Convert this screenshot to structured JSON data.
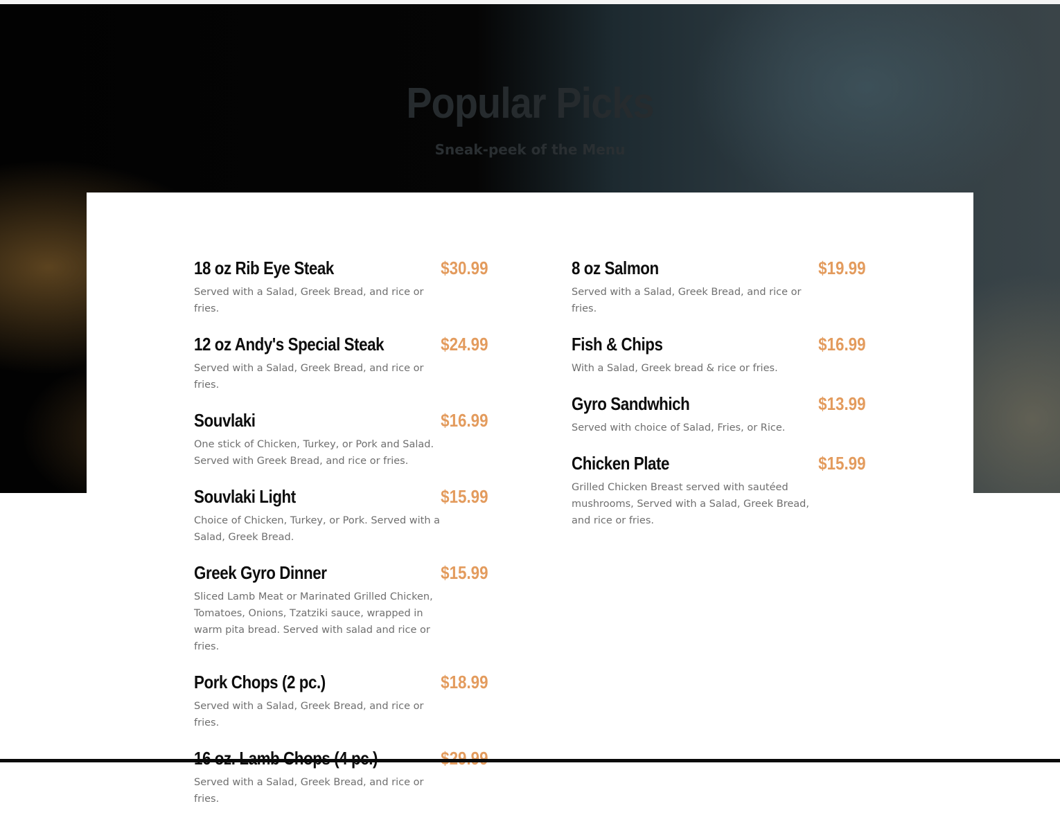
{
  "hero": {
    "title": "Popular Picks",
    "subtitle": "Sneak-peek of the Menu"
  },
  "colors": {
    "price": "#e39b5d",
    "item_name": "#0d0d0d",
    "description": "#6f6f6f"
  },
  "menu": {
    "left": [
      {
        "name": "18 oz Rib Eye Steak",
        "price": "$30.99",
        "description": "Served with a Salad, Greek Bread, and rice or fries."
      },
      {
        "name": "12 oz Andy's Special Steak",
        "price": "$24.99",
        "description": "Served with a Salad, Greek Bread, and rice or fries."
      },
      {
        "name": "Souvlaki",
        "price": "$16.99",
        "description": "One stick of Chicken, Turkey, or Pork and Salad. Served with Greek Bread, and rice or fries."
      },
      {
        "name": "Souvlaki Light",
        "price": "$15.99",
        "description": "Choice of Chicken, Turkey, or Pork. Served with a Salad, Greek Bread."
      },
      {
        "name": "Greek Gyro Dinner",
        "price": "$15.99",
        "description": "Sliced Lamb Meat or Marinated Grilled Chicken, Tomatoes, Onions, Tzatziki sauce, wrapped in warm pita bread. Served with salad and rice or fries."
      },
      {
        "name": "Pork Chops (2 pc.)",
        "price": "$18.99",
        "description": "Served with a Salad, Greek Bread, and rice or fries."
      },
      {
        "name": "16 oz. Lamb Chops (4 pc.)",
        "price": "$29.99",
        "description": "Served with a Salad, Greek Bread, and rice or fries."
      }
    ],
    "right": [
      {
        "name": "8 oz Salmon",
        "price": "$19.99",
        "description": "Served with a Salad, Greek Bread, and rice or fries."
      },
      {
        "name": "Fish & Chips",
        "price": "$16.99",
        "description": "With a Salad, Greek bread & rice or fries."
      },
      {
        "name": "Gyro Sandwhich",
        "price": "$13.99",
        "description": "Served with choice of Salad, Fries, or Rice."
      },
      {
        "name": "Chicken Plate",
        "price": "$15.99",
        "description": "Grilled Chicken Breast served with sautéed mushrooms, Served with a Salad, Greek Bread, and rice or fries."
      }
    ]
  }
}
